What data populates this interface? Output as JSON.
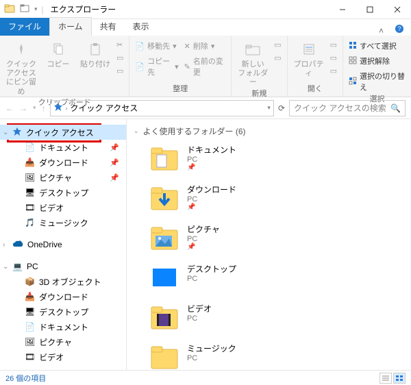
{
  "window": {
    "title": "エクスプローラー"
  },
  "tabs": {
    "file": "ファイル",
    "home": "ホーム",
    "share": "共有",
    "view": "表示"
  },
  "ribbon": {
    "clipboard": {
      "pin": "クイック アクセスにピン留め",
      "copy": "コピー",
      "paste": "貼り付け",
      "label": "クリップボード"
    },
    "organize": {
      "move": "移動先",
      "copyto": "コピー先",
      "delete": "削除",
      "rename": "名前の変更",
      "label": "整理"
    },
    "new": {
      "folder": "新しい\nフォルダー",
      "label": "新規"
    },
    "open": {
      "properties": "プロパティ",
      "label": "開く"
    },
    "select": {
      "all": "すべて選択",
      "none": "選択解除",
      "invert": "選択の切り替え",
      "label": "選択"
    }
  },
  "address": {
    "location": "クイック アクセス"
  },
  "search": {
    "placeholder": "クイック アクセスの検索"
  },
  "tree": {
    "quickaccess": "クイック アクセス",
    "documents": "ドキュメント",
    "downloads": "ダウンロード",
    "pictures": "ピクチャ",
    "desktop": "デスクトップ",
    "videos": "ビデオ",
    "music": "ミュージック",
    "onedrive": "OneDrive",
    "pc": "PC",
    "pc_3d": "3D オブジェクト",
    "pc_downloads": "ダウンロード",
    "pc_desktop": "デスクトップ",
    "pc_documents": "ドキュメント",
    "pc_pictures": "ピクチャ",
    "pc_videos": "ビデオ"
  },
  "main": {
    "group_header": "よく使用するフォルダー (6)",
    "items": [
      {
        "name": "ドキュメント",
        "sub": "PC"
      },
      {
        "name": "ダウンロード",
        "sub": "PC"
      },
      {
        "name": "ピクチャ",
        "sub": "PC"
      },
      {
        "name": "デスクトップ",
        "sub": "PC"
      },
      {
        "name": "ビデオ",
        "sub": "PC"
      },
      {
        "name": "ミュージック",
        "sub": "PC"
      }
    ]
  },
  "status": {
    "count": "26 個の項目"
  }
}
